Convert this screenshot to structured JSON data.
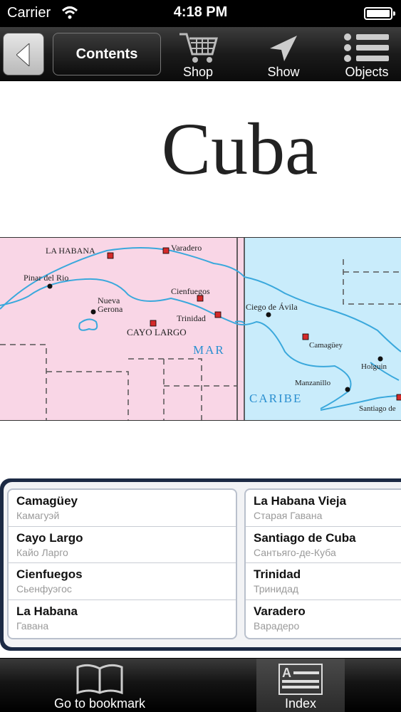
{
  "status": {
    "carrier": "Carrier",
    "time": "4:18 PM"
  },
  "toolbar": {
    "contents_label": "Contents",
    "shop_label": "Shop",
    "show_label": "Show",
    "objects_label": "Objects"
  },
  "page": {
    "title": "Cuba"
  },
  "map": {
    "labels": {
      "la_habana": "LA HABANA",
      "varadero": "Varadero",
      "pinar": "Pinar del Rio",
      "nueva": "Nueva",
      "gerona": "Gerona",
      "cienfuegos": "Cienfuegos",
      "trinidad": "Trinidad",
      "cayo": "CAYO LARGO",
      "mar": "MAR",
      "ciego": "Ciego de Ávila",
      "camaguey": "Camagüey",
      "holguin": "Holguin",
      "manzanillo": "Manzanillo",
      "caribe": "CARIBE",
      "santiago": "Santiago de"
    },
    "colors": {
      "left": "#f9d6e6",
      "right": "#c9ecfb",
      "coast": "#3aa8dc",
      "marker": "#d42a2a",
      "sea_text": "#2a8fd0"
    }
  },
  "list": {
    "left": [
      {
        "name": "Camagüey",
        "sub": "Камагуэй"
      },
      {
        "name": "Cayo Largo",
        "sub": "Кайо Ларго"
      },
      {
        "name": "Cienfuegos",
        "sub": "Сьенфуэгос"
      },
      {
        "name": "La Habana",
        "sub": "Гавана"
      }
    ],
    "right": [
      {
        "name": "La Habana Vieja",
        "sub": "Старая Гавана"
      },
      {
        "name": "Santiago de Cuba",
        "sub": "Сантьяго-де-Куба"
      },
      {
        "name": "Trinidad",
        "sub": "Тринидад"
      },
      {
        "name": "Varadero",
        "sub": "Варадеро"
      }
    ]
  },
  "tabbar": {
    "bookmark_label": "Go to bookmark",
    "index_label": "Index"
  }
}
